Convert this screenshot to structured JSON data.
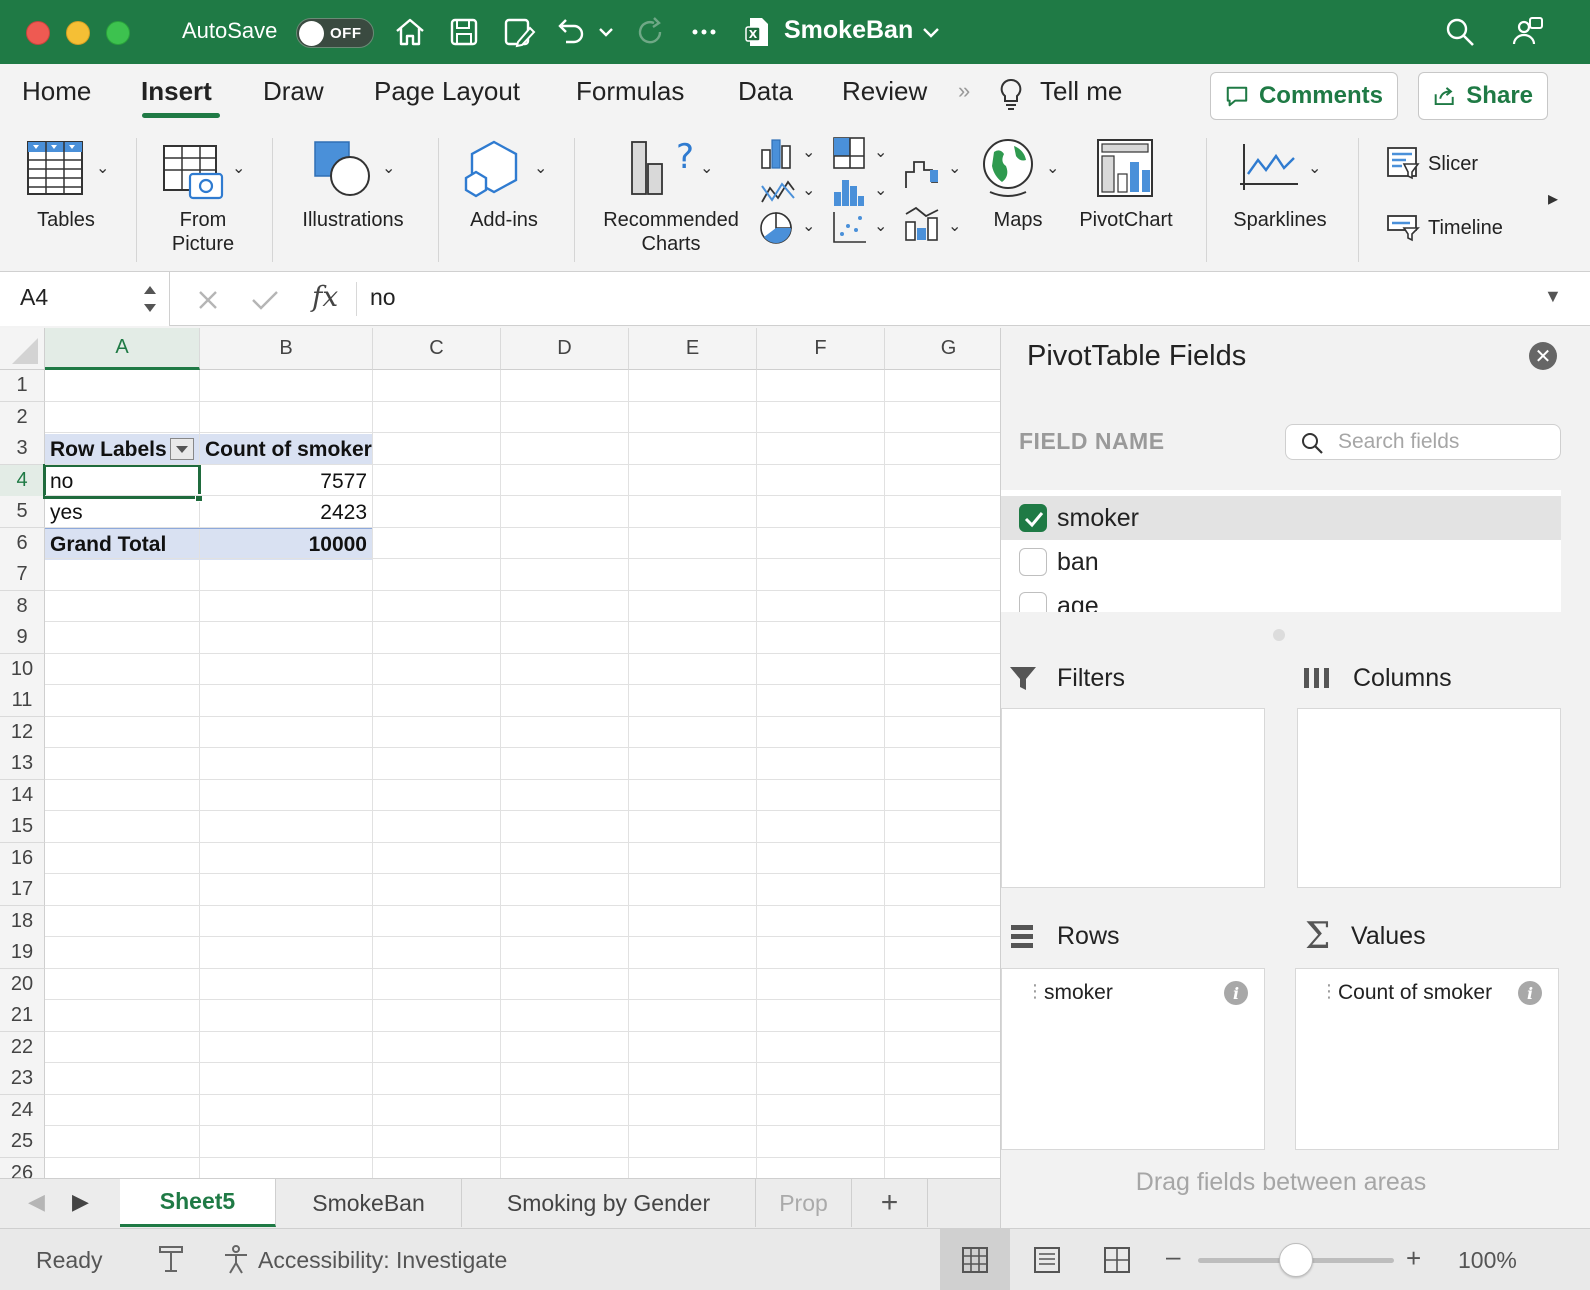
{
  "titlebar": {
    "autosave_label": "AutoSave",
    "autosave_state": "OFF",
    "document_name": "SmokeBan",
    "accent": "#1f7a45"
  },
  "ribbon_tabs": [
    "Home",
    "Insert",
    "Draw",
    "Page Layout",
    "Formulas",
    "Data",
    "Review",
    "Tell me"
  ],
  "active_tab": "Insert",
  "buttons": {
    "comments": "Comments",
    "share": "Share"
  },
  "ribbon": {
    "tables": "Tables",
    "from_picture_1": "From",
    "from_picture_2": "Picture",
    "illustrations": "Illustrations",
    "addins": "Add-ins",
    "recommended_1": "Recommended",
    "recommended_2": "Charts",
    "maps": "Maps",
    "pivotchart": "PivotChart",
    "sparklines": "Sparklines",
    "slicer": "Slicer",
    "timeline": "Timeline"
  },
  "formula_bar": {
    "cell_ref": "A4",
    "fx": "fx",
    "content": "no"
  },
  "columns": [
    "A",
    "B",
    "C",
    "D",
    "E",
    "F",
    "G"
  ],
  "rows": [
    "1",
    "2",
    "3",
    "4",
    "5",
    "6",
    "7",
    "8",
    "9",
    "10",
    "11",
    "12",
    "13",
    "14",
    "15",
    "16",
    "17",
    "18",
    "19",
    "20",
    "21",
    "22",
    "23",
    "24",
    "25",
    "26"
  ],
  "pivot_table": {
    "header_row_labels": "Row Labels",
    "header_count": "Count of smoker",
    "rows": [
      {
        "label": "no",
        "count": "7577"
      },
      {
        "label": "yes",
        "count": "2423"
      }
    ],
    "grand_total_label": "Grand Total",
    "grand_total_value": "10000"
  },
  "sheet_tabs": [
    "Sheet5",
    "SmokeBan",
    "Smoking by Gender",
    "Prop"
  ],
  "active_sheet": "Sheet5",
  "status": {
    "ready": "Ready",
    "accessibility": "Accessibility: Investigate",
    "zoom": "100%",
    "zoom_level": 0.5
  },
  "pivot_panel": {
    "title": "PivotTable Fields",
    "field_name_header": "FIELD NAME",
    "search_placeholder": "Search fields",
    "fields": [
      {
        "name": "smoker",
        "checked": true
      },
      {
        "name": "ban",
        "checked": false
      },
      {
        "name": "age",
        "checked": false
      }
    ],
    "areas": {
      "filters": "Filters",
      "columns": "Columns",
      "rows": "Rows",
      "values": "Values",
      "rows_item": "smoker",
      "values_item": "Count of smoker"
    },
    "drag_hint": "Drag fields between areas"
  }
}
